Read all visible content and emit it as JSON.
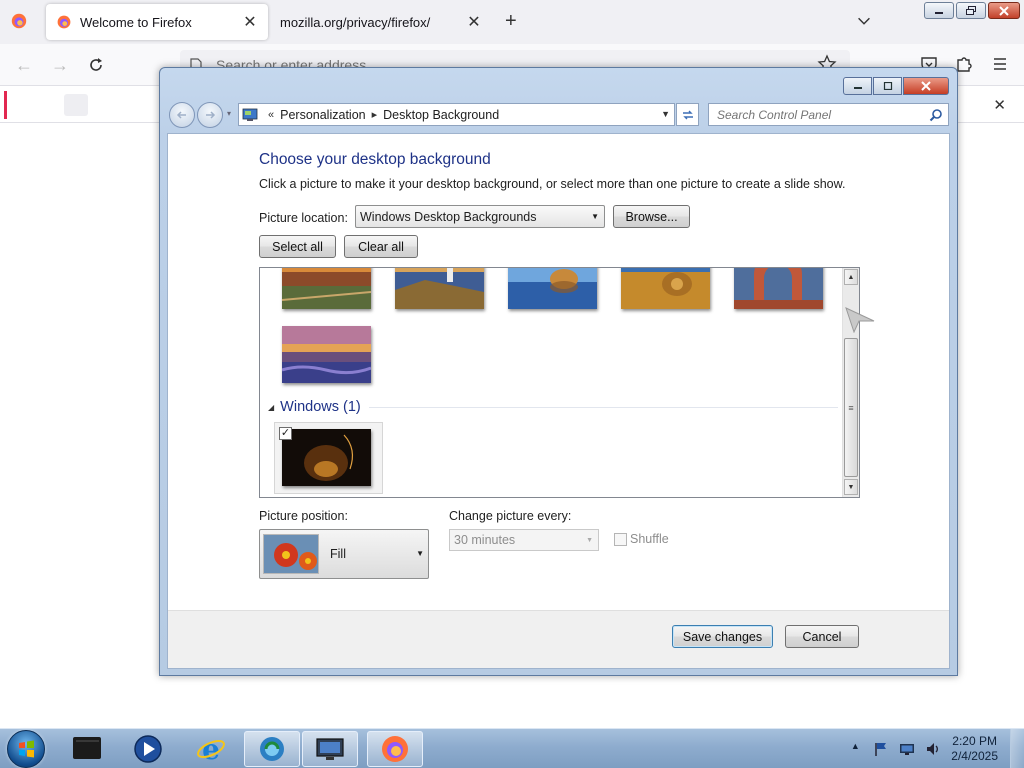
{
  "firefox": {
    "tabs": [
      {
        "title": "Welcome to Firefox",
        "active": true
      },
      {
        "title": "mozilla.org/privacy/firefox/",
        "active": false
      }
    ],
    "urlbar_placeholder": "Search or enter address",
    "close_glyph": "✕",
    "new_tab_glyph": "+"
  },
  "window": {
    "breadcrumb": [
      "Personalization",
      "Desktop Background"
    ],
    "search_placeholder": "Search Control Panel",
    "buttons": {
      "minimize": "—",
      "maximize": "☐",
      "close": "✕"
    }
  },
  "content": {
    "title": "Choose your desktop background",
    "description": "Click a picture to make it your desktop background, or select more than one picture to create a slide show.",
    "picture_location_label": "Picture location:",
    "picture_location_value": "Windows Desktop Backgrounds",
    "browse_label": "Browse...",
    "select_all_label": "Select all",
    "clear_all_label": "Clear all",
    "group_name": "Windows (1)",
    "thumbnails": [
      {
        "name": "sunset-field",
        "selected": false
      },
      {
        "name": "lighthouse-cliff",
        "selected": false
      },
      {
        "name": "rock-reflection",
        "selected": false
      },
      {
        "name": "hay-bale",
        "selected": false
      },
      {
        "name": "desert-arch",
        "selected": false
      },
      {
        "name": "lavender-sunset",
        "selected": false
      }
    ],
    "selected_image": {
      "name": "windows-default",
      "selected": true
    },
    "picture_position_label": "Picture position:",
    "picture_position_value": "Fill",
    "change_picture_label": "Change picture every:",
    "change_picture_value": "30 minutes",
    "shuffle_label": "Shuffle",
    "shuffle_checked": false,
    "save_label": "Save changes",
    "cancel_label": "Cancel"
  },
  "taskbar": {
    "time": "2:20 PM",
    "date": "2/4/2025"
  },
  "colors": {
    "accent_title": "#1e3287",
    "taskbar": "#8eacce",
    "window_frame": "#bcd0e8"
  }
}
